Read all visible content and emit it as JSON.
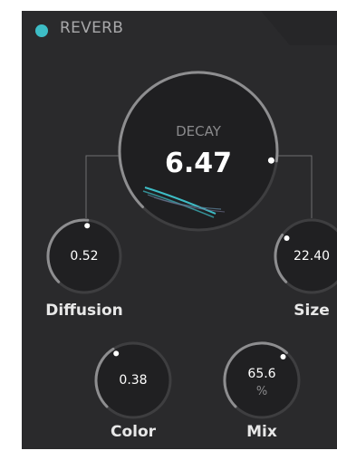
{
  "plugin": {
    "title": "REVERB",
    "accent": "#3dbdc6"
  },
  "decay": {
    "label": "DECAY",
    "value": "6.47",
    "level": 0.86
  },
  "knobs": {
    "diffusion": {
      "label": "Diffusion",
      "value": "0.52",
      "level": 0.52
    },
    "size": {
      "label": "Size",
      "value": "22.40",
      "level": 0.3
    },
    "color": {
      "label": "Color",
      "value": "0.38",
      "level": 0.38
    },
    "mix": {
      "label": "Mix",
      "value": "65.6",
      "unit": "%",
      "level": 0.656
    }
  }
}
